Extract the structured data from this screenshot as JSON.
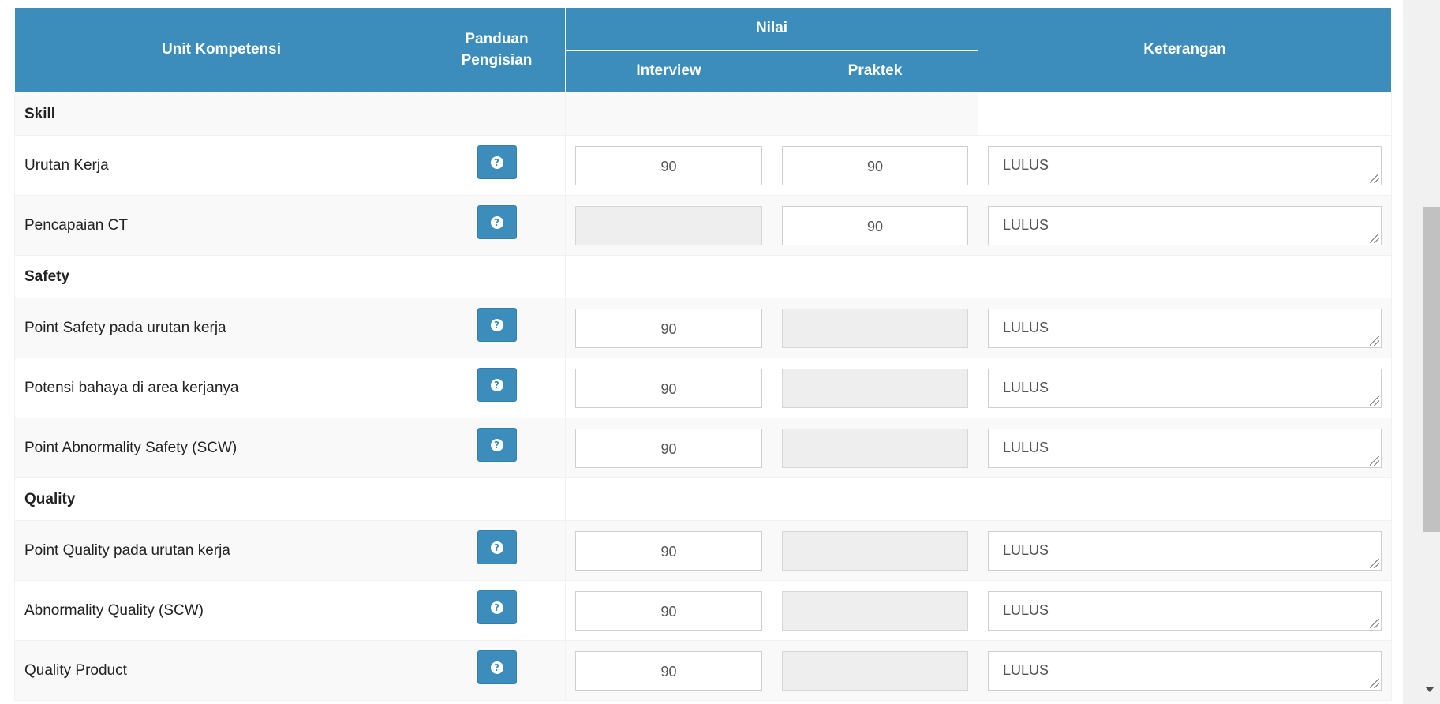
{
  "table": {
    "headers": {
      "unit": "Unit Kompetensi",
      "panduan": "Panduan Pengisian",
      "nilai": "Nilai",
      "interview": "Interview",
      "praktek": "Praktek",
      "keterangan": "Keterangan"
    },
    "categories": [
      {
        "name": "Skill",
        "items": [
          {
            "label": "Urutan Kerja",
            "interview": "90",
            "praktek": "90",
            "keterangan": "LULUS"
          },
          {
            "label": "Pencapaian CT",
            "interview": "",
            "praktek": "90",
            "keterangan": "LULUS"
          }
        ]
      },
      {
        "name": "Safety",
        "items": [
          {
            "label": "Point Safety pada urutan kerja",
            "interview": "90",
            "praktek": "",
            "keterangan": "LULUS"
          },
          {
            "label": "Potensi bahaya di area kerjanya",
            "interview": "90",
            "praktek": "",
            "keterangan": "LULUS"
          },
          {
            "label": "Point Abnormality Safety (SCW)",
            "interview": "90",
            "praktek": "",
            "keterangan": "LULUS"
          }
        ]
      },
      {
        "name": "Quality",
        "items": [
          {
            "label": "Point Quality pada urutan kerja",
            "interview": "90",
            "praktek": "",
            "keterangan": "LULUS"
          },
          {
            "label": "Abnormality Quality (SCW)",
            "interview": "90",
            "praktek": "",
            "keterangan": "LULUS"
          },
          {
            "label": "Quality Product",
            "interview": "90",
            "praktek": "",
            "keterangan": "LULUS"
          }
        ]
      }
    ]
  },
  "colors": {
    "header_bg": "#3c8dbc",
    "button_bg": "#3c8dbc",
    "disabled_input_bg": "#eeeeee"
  },
  "icons": {
    "help": "question-circle-icon"
  }
}
